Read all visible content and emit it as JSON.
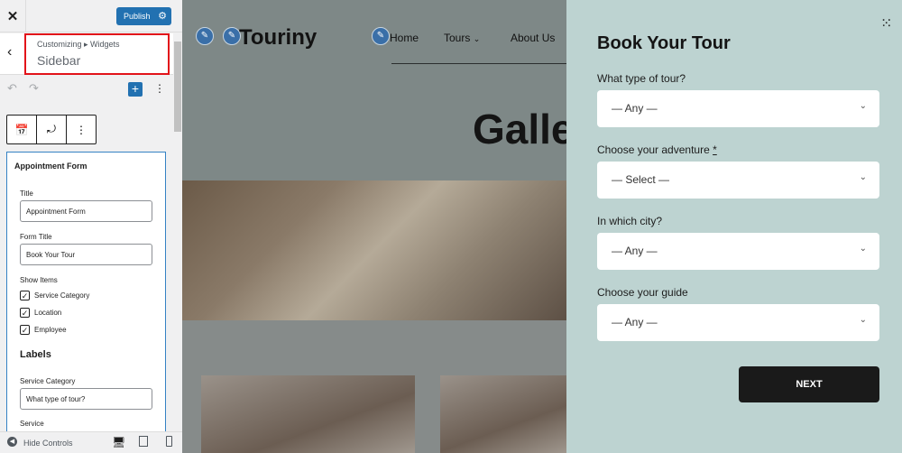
{
  "customizer": {
    "publish": "Publish",
    "breadcrumb": "Customizing ▸ Widgets",
    "section": "Sidebar",
    "widget": {
      "title": "Appointment Form",
      "fields": [
        {
          "label": "Title",
          "value": "Appointment Form"
        },
        {
          "label": "Form Title",
          "value": "Book Your Tour"
        }
      ],
      "show_items_label": "Show Items",
      "show_items": [
        {
          "label": "Service Category",
          "checked": true
        },
        {
          "label": "Location",
          "checked": true
        },
        {
          "label": "Employee",
          "checked": true
        }
      ],
      "labels_heading": "Labels",
      "service_category_label": "Service Category",
      "service_category_value": "What type of tour?",
      "service_label": "Service"
    },
    "hide_controls": "Hide Controls"
  },
  "preview": {
    "logo": "Touriny",
    "nav": [
      "Home",
      "Tours",
      "About Us"
    ],
    "heading": "Galle"
  },
  "modal": {
    "title": "Book Your Tour",
    "fields": [
      {
        "label": "What type of tour?",
        "value": "— Any —"
      },
      {
        "label": "Choose your adventure",
        "required": "*",
        "value": "— Select —"
      },
      {
        "label": "In which city?",
        "value": "— Any —"
      },
      {
        "label": "Choose your guide",
        "value": "— Any —"
      }
    ],
    "next": "NEXT"
  },
  "colors": {
    "accent": "#2271b1",
    "modal_bg": "#bdd3d1",
    "highlight": "#e2131a"
  }
}
